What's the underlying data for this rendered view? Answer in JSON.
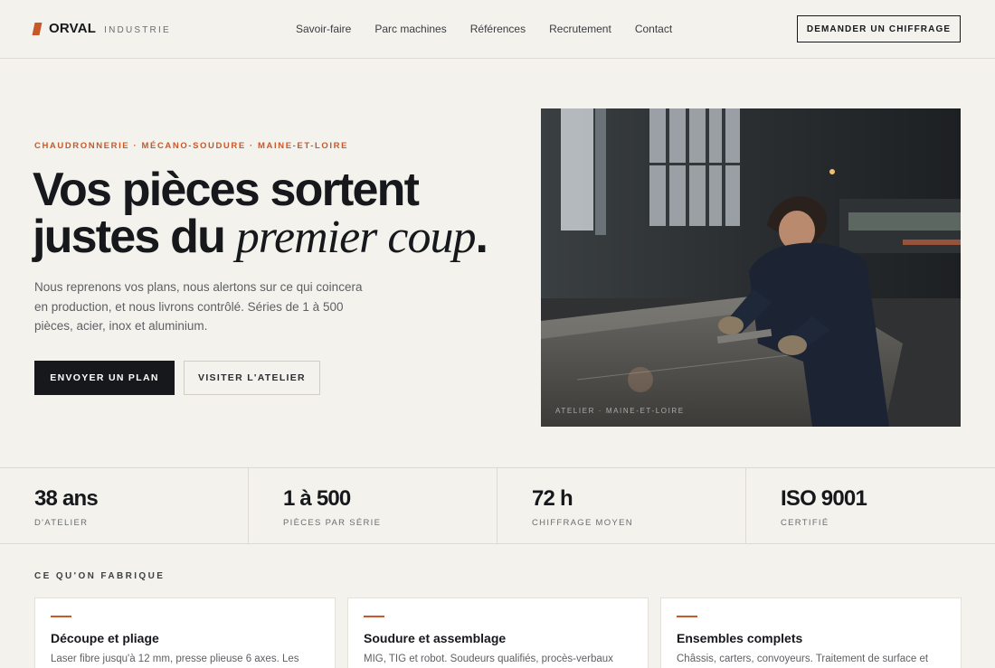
{
  "header": {
    "brand": "ORVAL",
    "brand_sub": "INDUSTRIE",
    "nav": [
      "Savoir-faire",
      "Parc machines",
      "Références",
      "Recrutement",
      "Contact"
    ],
    "cta": "DEMANDER UN CHIFFRAGE"
  },
  "hero": {
    "eyebrow": "CHAUDRONNERIE · MÉCANO-SOUDURE · MAINE-ET-LOIRE",
    "title_line1": "Vos pièces sortent",
    "title_line2_a": "justes du ",
    "title_line2_italic": "premier coup",
    "title_line2_end": ".",
    "lead": "Nous reprenons vos plans, nous alertons sur ce qui coincera en production, et nous livrons contrôlé. Séries de 1 à 500 pièces, acier, inox et aluminium.",
    "btn_primary": "ENVOYER UN PLAN",
    "btn_secondary": "VISITER L'ATELIER",
    "image_caption": "ATELIER · MAINE-ET-LOIRE"
  },
  "stats": [
    {
      "value": "38 ans",
      "label": "D'ATELIER"
    },
    {
      "value": "1 à 500",
      "label": "PIÈCES PAR SÉRIE"
    },
    {
      "value": "72 h",
      "label": "CHIFFRAGE MOYEN"
    },
    {
      "value": "ISO 9001",
      "label": "CERTIFIÉ"
    }
  ],
  "services": {
    "title": "CE QU'ON FABRIQUE",
    "cards": [
      {
        "title": "Découpe et pliage",
        "text": "Laser fibre jusqu'à 12 mm, presse plieuse 6 axes. Les"
      },
      {
        "title": "Soudure et assemblage",
        "text": "MIG, TIG et robot. Soudeurs qualifiés, procès-verbaux"
      },
      {
        "title": "Ensembles complets",
        "text": "Châssis, carters, convoyeurs. Traitement de surface et"
      }
    ]
  },
  "colors": {
    "accent": "#c8582a",
    "ink": "#16181c",
    "background": "#f3f2ed"
  }
}
